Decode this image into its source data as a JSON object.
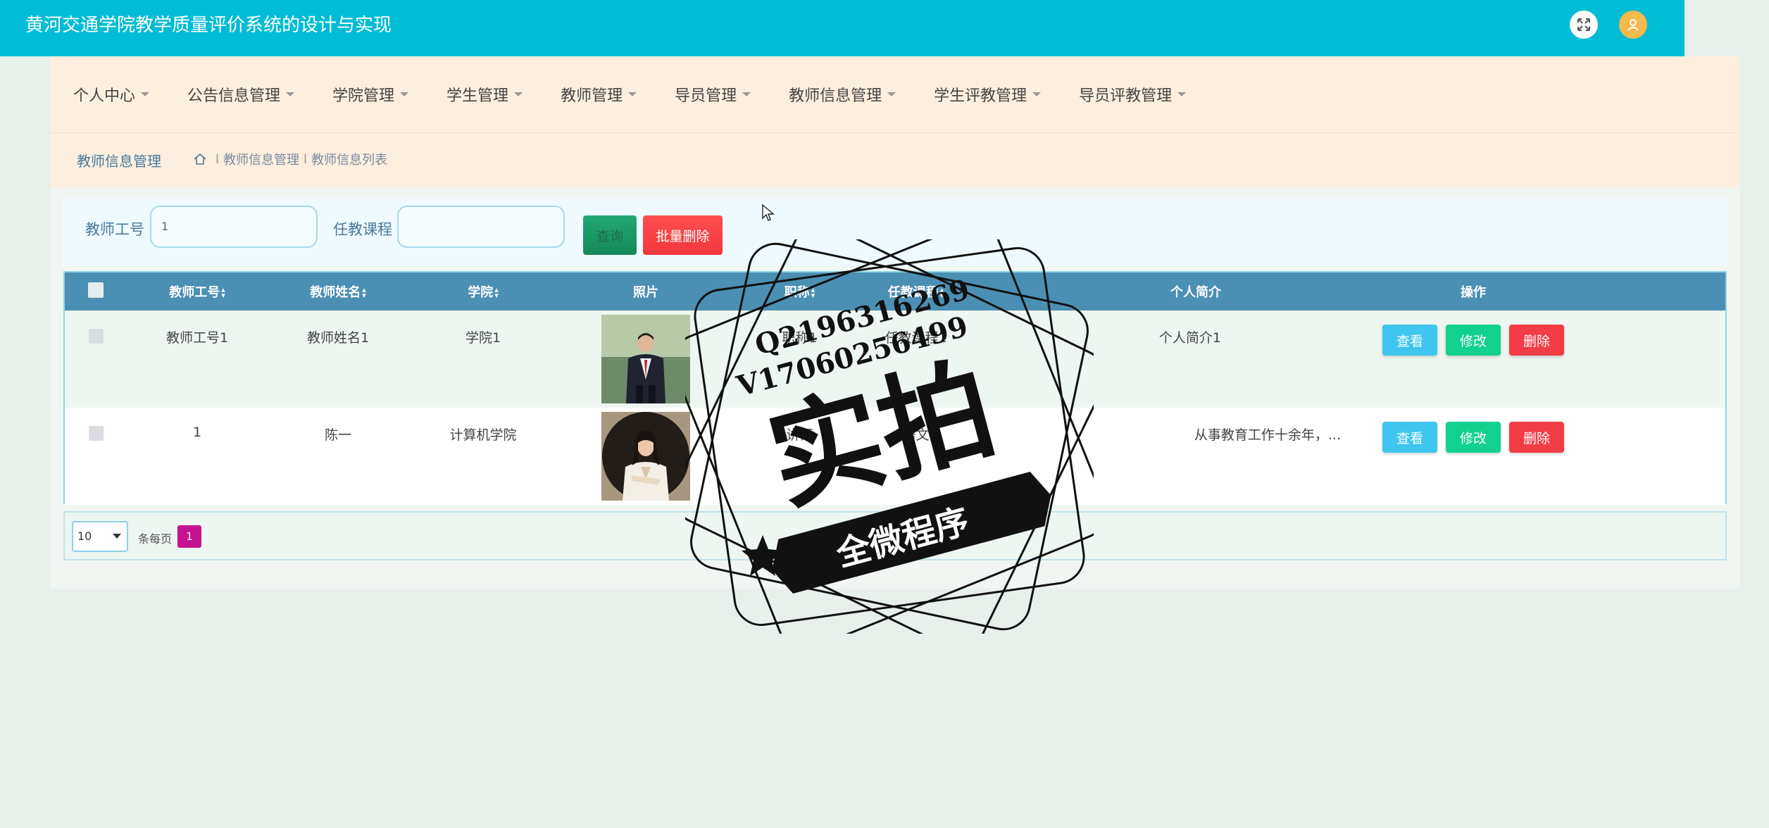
{
  "app": {
    "title": "黄河交通学院教学质量评价系统的设计与实现"
  },
  "header_icons": {
    "fullscreen": "expand-icon",
    "avatar": "user-icon",
    "avatar_color": "#f5b94d"
  },
  "nav": {
    "items": [
      {
        "label": "个人中心"
      },
      {
        "label": "公告信息管理"
      },
      {
        "label": "学院管理"
      },
      {
        "label": "学生管理"
      },
      {
        "label": "教师管理"
      },
      {
        "label": "导员管理"
      },
      {
        "label": "教师信息管理"
      },
      {
        "label": "学生评教管理"
      },
      {
        "label": "导员评教管理"
      }
    ]
  },
  "breadcrumb": {
    "module": "教师信息管理",
    "home_icon": "home-icon",
    "sep": "l",
    "level1": "教师信息管理",
    "level2": "教师信息列表"
  },
  "search": {
    "field1_label": "教师工号",
    "field1_value": "1",
    "field2_label": "任教课程",
    "field2_value": "",
    "query_label": "查询",
    "batch_delete_label": "批量删除"
  },
  "table": {
    "columns": [
      "教师工号",
      "教师姓名",
      "学院",
      "照片",
      "职称",
      "任教课程",
      "个人简介",
      "操作"
    ],
    "rows": [
      {
        "id": "教师工号1",
        "name": "教师姓名1",
        "college": "学院1",
        "photo": "man-photo",
        "title": "职称1",
        "course": "任教课程1",
        "intro": "个人简介1"
      },
      {
        "id": "1",
        "name": "陈一",
        "college": "计算机学院",
        "photo": "woman-photo",
        "title": "讲师",
        "course": "语文",
        "intro": "从事教育工作十余年，..."
      }
    ],
    "actions": {
      "view": "查看",
      "edit": "修改",
      "delete": "删除"
    }
  },
  "pagination": {
    "page_size": "10",
    "per_page_label": "条每页",
    "current_page": "1"
  },
  "watermark": {
    "contact1": "Q2196316269",
    "contact2": "V17060256499",
    "main": "实拍",
    "banner": "全微程序"
  },
  "colors": {
    "header": "#00bcd4",
    "nav_bg": "#fcefdf",
    "table_head": "#4b8fb4",
    "view": "#3fc6ef",
    "edit": "#12d18e",
    "delete": "#f23c46",
    "page_active": "#c6138f"
  }
}
